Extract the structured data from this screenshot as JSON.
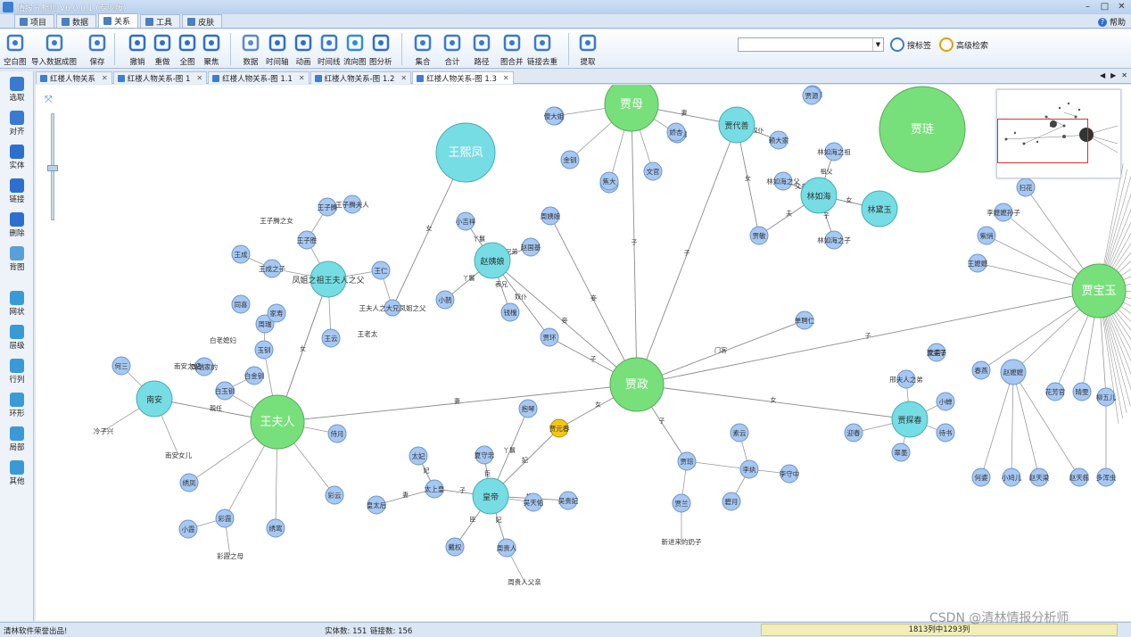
{
  "window": {
    "title": "情报分析师 V6.0.0.1 (专业版)"
  },
  "menu_tabs": [
    "项目",
    "数据",
    "关系",
    "工具",
    "皮肤"
  ],
  "help_label": "帮助",
  "ribbon": [
    {
      "label": "空白图",
      "icon": "blank-graph-icon"
    },
    {
      "label": "导入数据成图",
      "icon": "import-data-icon"
    },
    {
      "label": "保存",
      "icon": "save-icon"
    },
    {
      "label": "撤销",
      "icon": "undo-icon"
    },
    {
      "label": "重做",
      "icon": "redo-icon"
    },
    {
      "label": "全图",
      "icon": "fit-all-icon"
    },
    {
      "label": "聚焦",
      "icon": "focus-icon"
    },
    {
      "label": "数据",
      "icon": "data-table-icon"
    },
    {
      "label": "时间轴",
      "icon": "timeline-clock-icon"
    },
    {
      "label": "动画",
      "icon": "animation-icon"
    },
    {
      "label": "时间线",
      "icon": "time-line-icon"
    },
    {
      "label": "流向图",
      "icon": "flow-icon"
    },
    {
      "label": "图分析",
      "icon": "graph-analysis-icon"
    },
    {
      "label": "集合",
      "icon": "set-icon"
    },
    {
      "label": "合计",
      "icon": "sum-icon"
    },
    {
      "label": "路径",
      "icon": "path-icon"
    },
    {
      "label": "图合并",
      "icon": "merge-icon"
    },
    {
      "label": "链接去重",
      "icon": "dedupe-icon"
    },
    {
      "label": "提取",
      "icon": "extract-icon"
    }
  ],
  "search": {
    "value": "",
    "placeholder": ""
  },
  "search_buttons": [
    {
      "label": "搜标签",
      "icon": "search-label-icon"
    },
    {
      "label": "高级检索",
      "icon": "advanced-search-icon"
    }
  ],
  "doc_tabs": [
    {
      "label": "红楼人物关系",
      "active": false
    },
    {
      "label": "红楼人物关系-图 1",
      "active": false
    },
    {
      "label": "红楼人物关系-图 1.1",
      "active": false
    },
    {
      "label": "红楼人物关系-图 1.2",
      "active": false
    },
    {
      "label": "红楼人物关系-图 1.3",
      "active": true
    }
  ],
  "left_tools": [
    {
      "label": "选取",
      "icon": "select-icon"
    },
    {
      "label": "对齐",
      "icon": "align-icon"
    },
    {
      "label": "实体",
      "icon": "entity-icon"
    },
    {
      "label": "链接",
      "icon": "link-icon"
    },
    {
      "label": "删除",
      "icon": "delete-icon"
    },
    {
      "label": "背图",
      "icon": "background-image-icon"
    },
    {
      "label": "网状",
      "icon": "network-layout-icon"
    },
    {
      "label": "层级",
      "icon": "hierarchy-layout-icon"
    },
    {
      "label": "行列",
      "icon": "grid-layout-icon"
    },
    {
      "label": "环形",
      "icon": "circle-layout-icon"
    },
    {
      "label": "局部",
      "icon": "local-layout-icon"
    },
    {
      "label": "其他",
      "icon": "other-layout-icon"
    }
  ],
  "colors": {
    "green": "#77e07a",
    "cyan": "#75dde3",
    "blue": "#a6c8f3",
    "orange": "#f5c517",
    "edge": "#8c8c8c"
  },
  "graph": {
    "nodes": [
      {
        "id": "jiazheng",
        "label": "贾政",
        "kind": "green",
        "r": 30
      },
      {
        "id": "wangfuren",
        "label": "王夫人",
        "kind": "green",
        "r": 30
      },
      {
        "id": "jiamu",
        "label": "贾母",
        "kind": "green",
        "r": 30
      },
      {
        "id": "jialian",
        "label": "贾琏",
        "kind": "green",
        "r": 48
      },
      {
        "id": "baoyu",
        "label": "贾宝玉",
        "kind": "green",
        "r": 30
      },
      {
        "id": "wangxifeng",
        "label": "王熙凤",
        "kind": "cyan",
        "r": 33
      },
      {
        "id": "zhaoyiniang",
        "label": "赵姨娘",
        "kind": "cyan",
        "r": 20
      },
      {
        "id": "wangfu_father",
        "label": "凤姐之祖王夫人之父",
        "kind": "cyan",
        "r": 20
      },
      {
        "id": "wangfurenfx",
        "label": "王夫人之大兄凤姐之父",
        "kind": "blue",
        "r": 9
      },
      {
        "id": "huangdi",
        "label": "皇帝",
        "kind": "cyan",
        "r": 20
      },
      {
        "id": "jiataoshou",
        "label": "贾代善",
        "kind": "cyan",
        "r": 20
      },
      {
        "id": "linruhai",
        "label": "林如海",
        "kind": "cyan",
        "r": 20
      },
      {
        "id": "lindaiyu",
        "label": "林黛玉",
        "kind": "cyan",
        "r": 20
      },
      {
        "id": "jiatanchun",
        "label": "贾探春",
        "kind": "cyan",
        "r": 20
      },
      {
        "id": "nanan",
        "label": "南安",
        "kind": "cyan",
        "r": 20
      },
      {
        "id": "yuanchun",
        "label": "贾元春",
        "kind": "orange",
        "r": 10
      },
      {
        "id": "zhaoguoji",
        "label": "赵国基",
        "kind": "blue",
        "r": 10
      },
      {
        "id": "xiaojiqin",
        "label": "小吉祥",
        "kind": "blue",
        "r": 10
      },
      {
        "id": "xiaoque",
        "label": "小鹊",
        "kind": "blue",
        "r": 10
      },
      {
        "id": "qianhuai",
        "label": "钱槐",
        "kind": "blue",
        "r": 10
      },
      {
        "id": "jiahuan",
        "label": "贾环",
        "kind": "blue",
        "r": 10
      },
      {
        "id": "zhouyiniang",
        "label": "周姨娘",
        "kind": "blue",
        "r": 10
      },
      {
        "id": "shanpinren",
        "label": "单聘仁",
        "kind": "blue",
        "r": 10
      },
      {
        "id": "baoqin",
        "label": "抱琴",
        "kind": "blue",
        "r": 10
      },
      {
        "id": "jiagui",
        "label": "贾琮",
        "kind": "blue",
        "r": 10
      },
      {
        "id": "jialan",
        "label": "贾兰",
        "kind": "blue",
        "r": 10
      },
      {
        "id": "suyun",
        "label": "素云",
        "kind": "blue",
        "r": 10
      },
      {
        "id": "lisao",
        "label": "李纨",
        "kind": "blue",
        "r": 10
      },
      {
        "id": "lishouzhong",
        "label": "李守中",
        "kind": "blue",
        "r": 10
      },
      {
        "id": "biyue",
        "label": "碧月",
        "kind": "blue",
        "r": 10
      },
      {
        "id": "xinjinaimao",
        "label": "新进来的奶子",
        "kind": "blue",
        "r": 0
      },
      {
        "id": "jiaxiaoer",
        "label": "贾小儿",
        "kind": "blue",
        "r": 0
      },
      {
        "id": "shiyue",
        "label": "侍月",
        "kind": "blue",
        "r": 10
      },
      {
        "id": "caiyun",
        "label": "彩云",
        "kind": "blue",
        "r": 10
      },
      {
        "id": "caiyun2",
        "label": "彩霞",
        "kind": "blue",
        "r": 10
      },
      {
        "id": "xiaoxia",
        "label": "小霞",
        "kind": "blue",
        "r": 10
      },
      {
        "id": "caixiazhimu",
        "label": "彩霞之母",
        "kind": "blue",
        "r": 0
      },
      {
        "id": "xiuyuan",
        "label": "绣凤",
        "kind": "blue",
        "r": 10
      },
      {
        "id": "xiuluan",
        "label": "绣鸾",
        "kind": "blue",
        "r": 10
      },
      {
        "id": "zhuxia",
        "label": "玉钏",
        "kind": "blue",
        "r": 10
      },
      {
        "id": "baiyuchuan",
        "label": "白玉钏",
        "kind": "blue",
        "r": 10
      },
      {
        "id": "baijinchuan",
        "label": "白金钏",
        "kind": "blue",
        "r": 10
      },
      {
        "id": "bailaopo",
        "label": "白老媳妇",
        "kind": "blue",
        "r": 0
      },
      {
        "id": "zhouqi",
        "label": "周瑞",
        "kind": "blue",
        "r": 10
      },
      {
        "id": "zhouqi2",
        "label": "周瑞家的",
        "kind": "blue",
        "r": 10
      },
      {
        "id": "jiashi",
        "label": "家寿",
        "kind": "blue",
        "r": 10
      },
      {
        "id": "tongxi",
        "label": "同喜",
        "kind": "blue",
        "r": 10
      },
      {
        "id": "wangcheng",
        "label": "王成",
        "kind": "blue",
        "r": 10
      },
      {
        "id": "wangchengzi",
        "label": "王成之子",
        "kind": "blue",
        "r": 10
      },
      {
        "id": "wangziteng",
        "label": "王子腾",
        "kind": "blue",
        "r": 10
      },
      {
        "id": "wangzisheng",
        "label": "王子胜",
        "kind": "blue",
        "r": 10
      },
      {
        "id": "wangziteng_wife",
        "label": "王子腾夫人",
        "kind": "blue",
        "r": 10
      },
      {
        "id": "wangzitengnv",
        "label": "王子腾之女",
        "kind": "blue",
        "r": 0
      },
      {
        "id": "wangren",
        "label": "王仁",
        "kind": "blue",
        "r": 10
      },
      {
        "id": "wangyun",
        "label": "王云",
        "kind": "blue",
        "r": 10
      },
      {
        "id": "wanglaotai",
        "label": "王老太",
        "kind": "blue",
        "r": 0
      },
      {
        "id": "heyi",
        "label": "何三",
        "kind": "blue",
        "r": 10
      },
      {
        "id": "lengzixing",
        "label": "冷子兴",
        "kind": "blue",
        "r": 0
      },
      {
        "id": "nanan_laotai",
        "label": "南安太妃",
        "kind": "blue",
        "r": 0
      },
      {
        "id": "nanan_nver",
        "label": "南安女儿",
        "kind": "blue",
        "r": 0
      },
      {
        "id": "zhourui_niang",
        "label": "周瑞的儿子",
        "kind": "blue",
        "r": 0
      },
      {
        "id": "taifei",
        "label": "太妃",
        "kind": "blue",
        "r": 10
      },
      {
        "id": "taishanghuang",
        "label": "太上皇",
        "kind": "blue",
        "r": 10
      },
      {
        "id": "huangtaihou",
        "label": "皇太后",
        "kind": "blue",
        "r": 10
      },
      {
        "id": "xiashouzhong",
        "label": "夏守忠",
        "kind": "blue",
        "r": 10
      },
      {
        "id": "daiquan",
        "label": "戴权",
        "kind": "blue",
        "r": 10
      },
      {
        "id": "zhoutaifei",
        "label": "周贵人",
        "kind": "blue",
        "r": 10
      },
      {
        "id": "zhoutaifeifu",
        "label": "周贵人父亲",
        "kind": "blue",
        "r": 0
      },
      {
        "id": "wutianyou",
        "label": "吴天佑",
        "kind": "blue",
        "r": 10
      },
      {
        "id": "wuguifei",
        "label": "吴贵妃",
        "kind": "blue",
        "r": 10
      },
      {
        "id": "laidaru",
        "label": "赖大家",
        "kind": "blue",
        "r": 10
      },
      {
        "id": "hupo",
        "label": "琥珀",
        "kind": "blue",
        "r": 10
      },
      {
        "id": "jinli",
        "label": "金钏",
        "kind": "blue",
        "r": 10
      },
      {
        "id": "wenguan",
        "label": "文官",
        "kind": "blue",
        "r": 10
      },
      {
        "id": "yuanyang",
        "label": "鸳鸯",
        "kind": "blue",
        "r": 10
      },
      {
        "id": "jiadaiyi",
        "label": "贾代儒",
        "kind": "blue",
        "r": 10
      },
      {
        "id": "jiadaixiu",
        "label": "贾代修",
        "kind": "blue",
        "r": 10
      },
      {
        "id": "jiaxiaojia",
        "label": "傻大姐",
        "kind": "blue",
        "r": 10
      },
      {
        "id": "jiaobao",
        "label": "焦大",
        "kind": "blue",
        "r": 10
      },
      {
        "id": "lin_zu",
        "label": "林如海之祖",
        "kind": "blue",
        "r": 10
      },
      {
        "id": "lin_fu",
        "label": "林如海之父",
        "kind": "blue",
        "r": 10
      },
      {
        "id": "lin_zi",
        "label": "林如海之子",
        "kind": "blue",
        "r": 10
      },
      {
        "id": "jiamin",
        "label": "贾敏",
        "kind": "blue",
        "r": 10
      },
      {
        "id": "jiayuan",
        "label": "贾源",
        "kind": "blue",
        "r": 10
      },
      {
        "id": "jiaoxing",
        "label": "娇杏",
        "kind": "blue",
        "r": 10
      },
      {
        "id": "yuanchun_shi",
        "label": "抱琴2",
        "kind": "blue",
        "r": 0
      },
      {
        "id": "danchunyi",
        "label": "迎春",
        "kind": "blue",
        "r": 10
      },
      {
        "id": "tanchun_a",
        "label": "待书",
        "kind": "blue",
        "r": 10
      },
      {
        "id": "tanchun_b",
        "label": "小蝉",
        "kind": "blue",
        "r": 10
      },
      {
        "id": "tanchun_c",
        "label": "翠墨",
        "kind": "blue",
        "r": 10
      },
      {
        "id": "tanchun_d",
        "label": "邢夫人之弟",
        "kind": "blue",
        "r": 10
      },
      {
        "id": "tanchun_e",
        "label": "文官2",
        "kind": "blue",
        "r": 10
      },
      {
        "id": "tanchun_f",
        "label": "夏婆子",
        "kind": "blue",
        "r": 0
      },
      {
        "id": "b_qiwen",
        "label": "扫花",
        "kind": "blue",
        "r": 10
      },
      {
        "id": "b_lmm",
        "label": "李嬷嬷孙子",
        "kind": "blue",
        "r": 10
      },
      {
        "id": "b_ziyu",
        "label": "紫绡",
        "kind": "blue",
        "r": 10
      },
      {
        "id": "b_wangmm",
        "label": "王嬷嬷",
        "kind": "blue",
        "r": 10
      },
      {
        "id": "b_chunyan",
        "label": "春燕",
        "kind": "blue",
        "r": 10
      },
      {
        "id": "b_zhaomm",
        "label": "赵嬷嬷",
        "kind": "blue",
        "r": 14
      },
      {
        "id": "b_hfy",
        "label": "花芳官",
        "kind": "blue",
        "r": 10
      },
      {
        "id": "b_qingwen",
        "label": "晴雯",
        "kind": "blue",
        "r": 10
      },
      {
        "id": "b_yuer",
        "label": "柳五儿",
        "kind": "blue",
        "r": 10
      },
      {
        "id": "b_yichun",
        "label": "何婆",
        "kind": "blue",
        "r": 10
      },
      {
        "id": "b_xiaoyan",
        "label": "小鸠儿",
        "kind": "blue",
        "r": 10
      },
      {
        "id": "b_zhaotianl",
        "label": "赵天梁",
        "kind": "blue",
        "r": 10
      },
      {
        "id": "b_zhaotiand",
        "label": "赵天栋",
        "kind": "blue",
        "r": 10
      },
      {
        "id": "b_duoguanr",
        "label": "多浑虫",
        "kind": "blue",
        "r": 10
      }
    ],
    "edges": [
      {
        "s": "wangfuren",
        "t": "jiazheng",
        "label": "妻"
      },
      {
        "s": "zhaoyiniang",
        "t": "jiazheng",
        "label": "妾"
      },
      {
        "s": "zhouyiniang",
        "t": "jiazheng",
        "label": "妾"
      },
      {
        "s": "jiahuan",
        "t": "jiazheng",
        "label": "子"
      },
      {
        "s": "jiamu",
        "t": "jiazheng",
        "label": "子"
      },
      {
        "s": "jiataoshou",
        "t": "jiazheng",
        "label": "子"
      },
      {
        "s": "shanpinren",
        "t": "jiazheng",
        "label": "门客"
      },
      {
        "s": "baoyu",
        "t": "jiazheng",
        "label": "子"
      },
      {
        "s": "jiatanchun",
        "t": "jiazheng",
        "label": "女"
      },
      {
        "s": "yuanchun",
        "t": "jiazheng",
        "label": "女"
      },
      {
        "s": "jiagui",
        "t": "jiazheng",
        "label": "子"
      },
      {
        "s": "wangxifeng",
        "t": "wangfurenfx",
        "label": "女"
      },
      {
        "s": "nanan",
        "t": "wangfuren",
        "label": "親任"
      },
      {
        "s": "wangfu_father",
        "t": "wangfuren",
        "label": "女"
      },
      {
        "s": "zhaoyiniang",
        "t": "qianhuai",
        "label": "表兄"
      },
      {
        "s": "zhaoyiniang",
        "t": "zhaoguoji",
        "label": "兄弟"
      },
      {
        "s": "zhaoyiniang",
        "t": "xiaojiqin",
        "label": "丫鬟"
      },
      {
        "s": "zhaoyiniang",
        "t": "xiaoque",
        "label": "丫鬟"
      },
      {
        "s": "jiahuan",
        "t": "zhaoyiniang",
        "label": "奴仆"
      },
      {
        "s": "yuanchun",
        "t": "huangdi",
        "label": "妃"
      },
      {
        "s": "huangdi",
        "t": "taishanghuang",
        "label": "子"
      },
      {
        "s": "huangdi",
        "t": "wuguifei",
        "label": "妃"
      },
      {
        "s": "huangdi",
        "t": "zhoutaifei",
        "label": "妃"
      },
      {
        "s": "huangdi",
        "t": "xiashouzhong",
        "label": "臣"
      },
      {
        "s": "huangdi",
        "t": "daiquan",
        "label": "臣"
      },
      {
        "s": "huangdi",
        "t": "baoqin",
        "label": "丫鬟"
      },
      {
        "s": "taishanghuang",
        "t": "huangtaihou",
        "label": "妻"
      },
      {
        "s": "taishanghuang",
        "t": "taifei",
        "label": "妃"
      },
      {
        "s": "jiataoshou",
        "t": "jiamu",
        "label": "妻"
      },
      {
        "s": "jiataoshou",
        "t": "laidaru",
        "label": "奴仆"
      },
      {
        "s": "jiataoshou",
        "t": "jiamin",
        "label": "女"
      },
      {
        "s": "jiamin",
        "t": "linruhai",
        "label": "夫"
      },
      {
        "s": "lindaiyu",
        "t": "linruhai",
        "label": "女"
      },
      {
        "s": "linruhai",
        "t": "lin_fu",
        "label": "父亲"
      },
      {
        "s": "linruhai",
        "t": "lin_zi",
        "label": "子"
      },
      {
        "s": "linruhai",
        "t": "lin_zu",
        "label": "祖父"
      }
    ]
  },
  "status": {
    "left": "清林软件荣誉出品!",
    "entity_count": "实体数: 151",
    "link_count": "链接数: 156",
    "coords": "1813列中1293列"
  },
  "watermark": "CSDN @清林情报分析师"
}
